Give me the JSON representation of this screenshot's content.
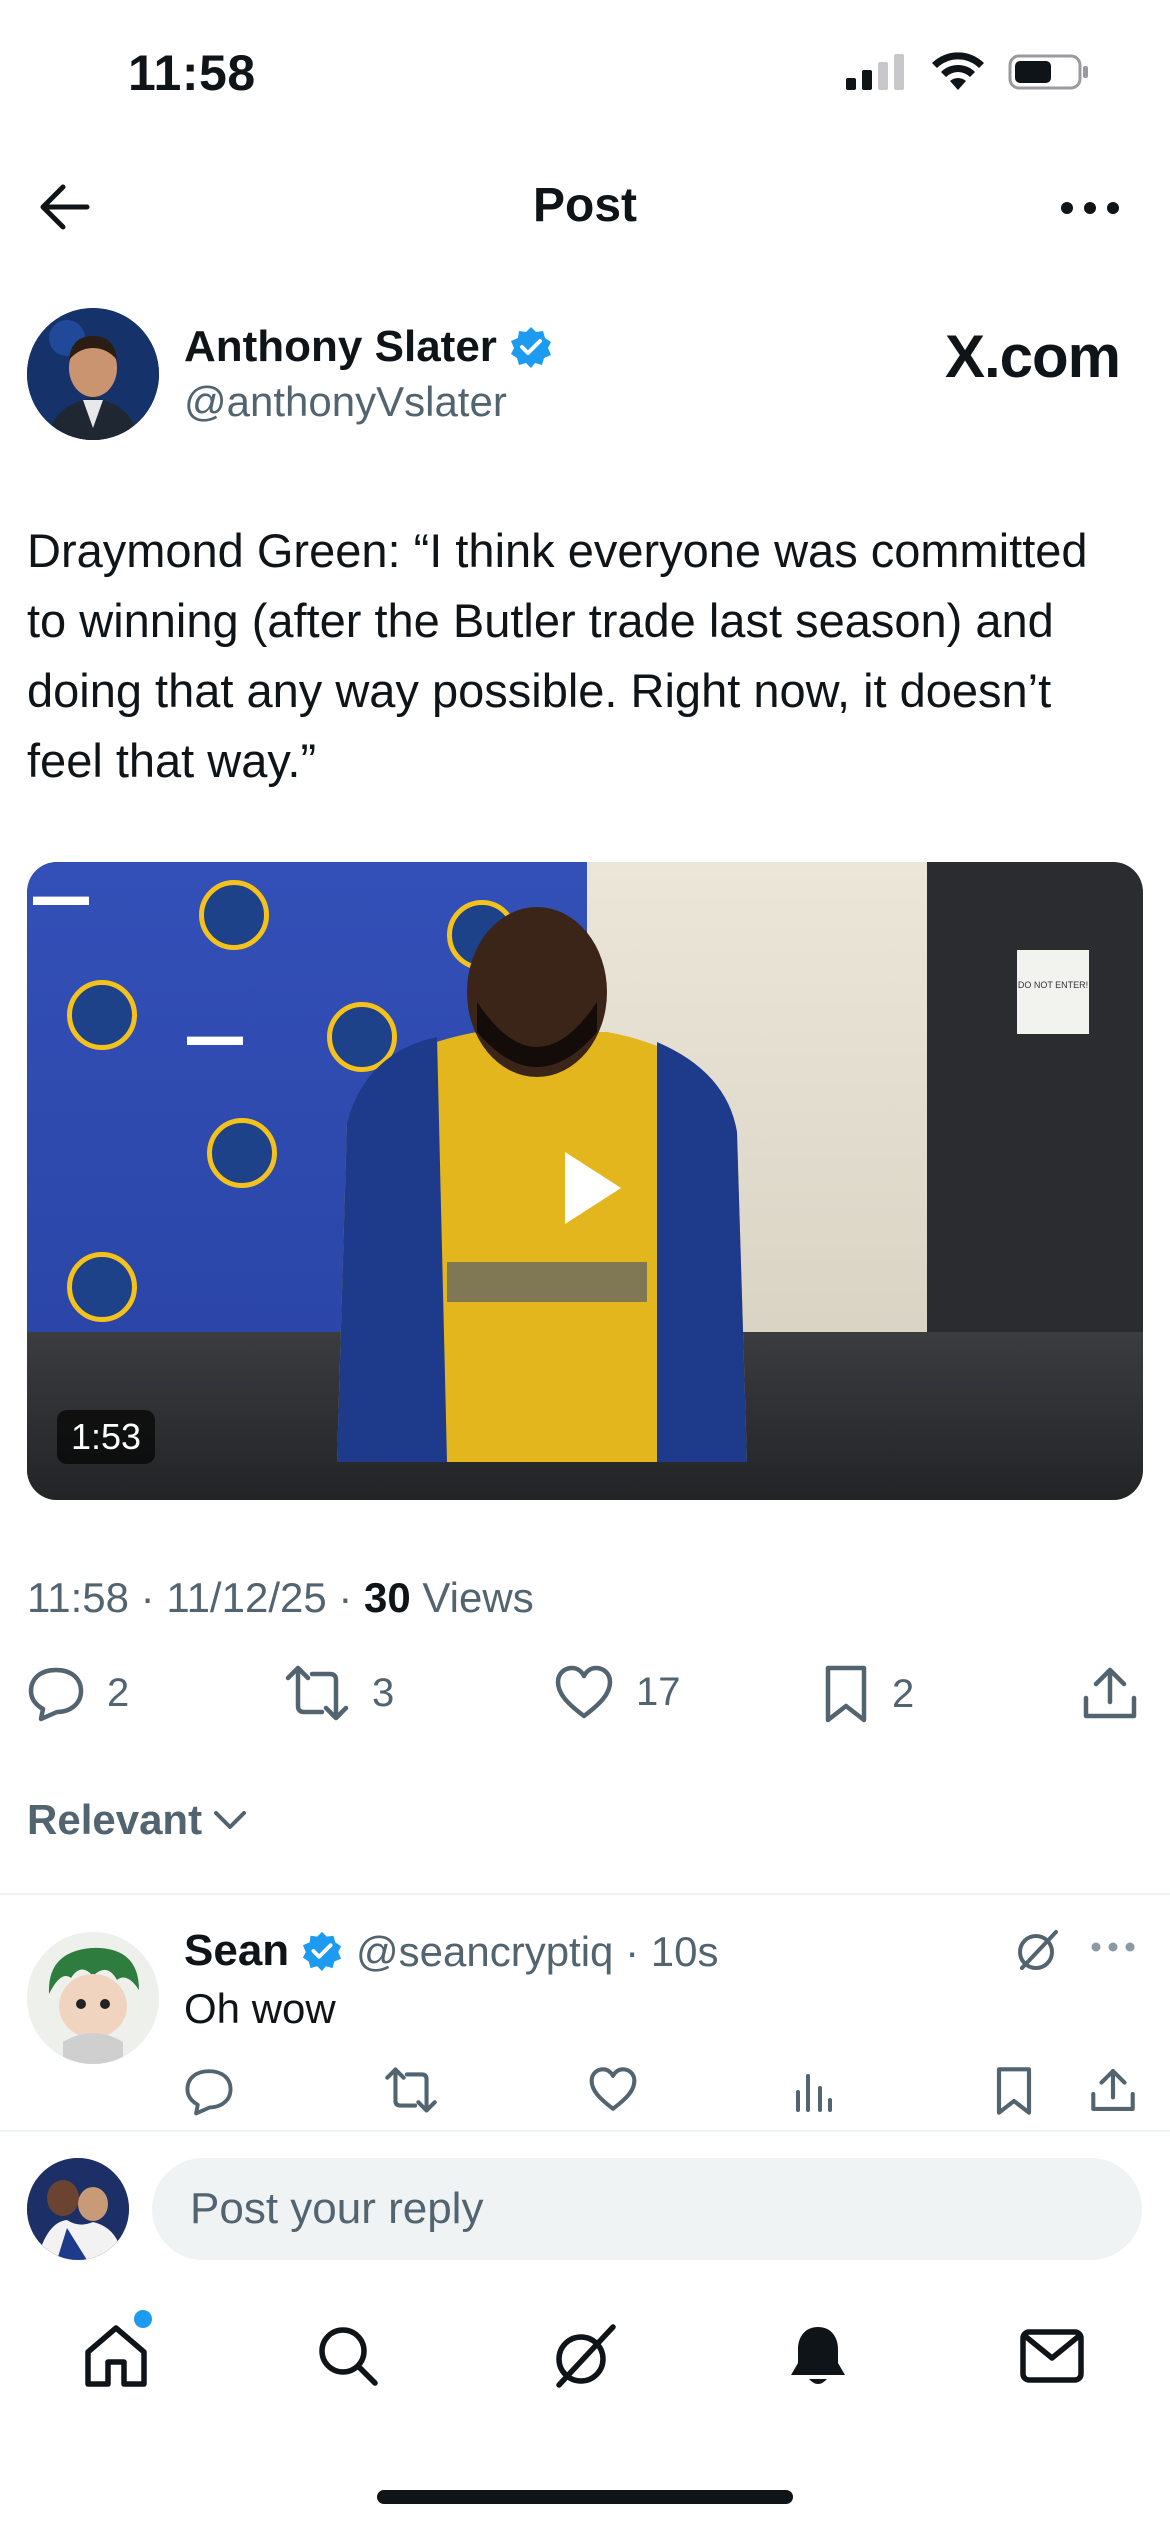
{
  "status_bar": {
    "time": "11:58"
  },
  "header": {
    "title": "Post"
  },
  "post": {
    "author_name": "Anthony Slater",
    "author_handle": "@anthonyVslater",
    "source_label": "X.com",
    "text": "Draymond Green: “I think everyone was committed to winning (after the Butler trade last season) and doing that any way possible. Right now, it doesn’t feel that way.”",
    "video_duration": "1:53",
    "video_sign": "DO NOT ENTER!",
    "time": "11:58",
    "date": "11/12/25",
    "views_count": "30",
    "views_label": "Views",
    "replies": "2",
    "reposts": "3",
    "likes": "17",
    "bookmarks": "2"
  },
  "sort": {
    "label": "Relevant"
  },
  "reply": {
    "name": "Sean",
    "handle": "@seancryptiq",
    "age": "10s",
    "text": "Oh wow"
  },
  "composer": {
    "placeholder": "Post your reply"
  },
  "colors": {
    "accent": "#1d9bf0",
    "text": "#0f1419",
    "muted": "#536471",
    "divider": "#eff3f4"
  },
  "icons": {
    "tab_bar": [
      "home-icon",
      "search-icon",
      "grok-icon",
      "notifications-icon",
      "messages-icon"
    ]
  }
}
